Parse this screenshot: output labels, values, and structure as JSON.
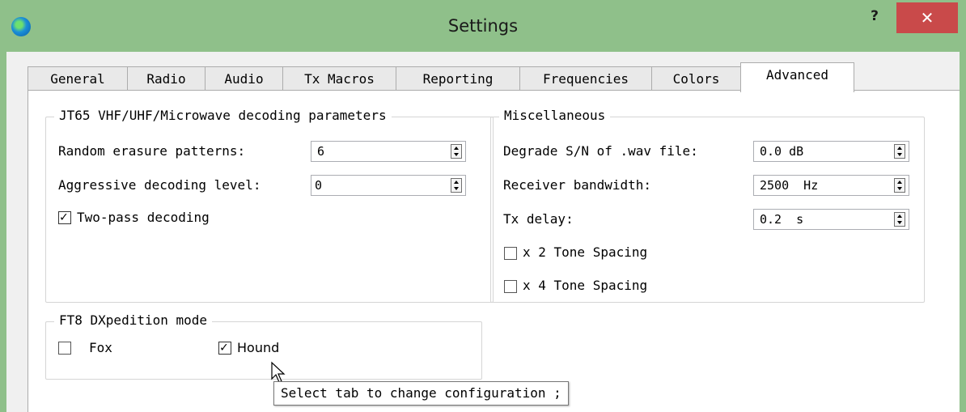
{
  "window": {
    "title": "Settings",
    "help_label": "?",
    "close_label": "✕"
  },
  "tabs": [
    {
      "label": "General"
    },
    {
      "label": "Radio"
    },
    {
      "label": "Audio"
    },
    {
      "label": "Tx Macros"
    },
    {
      "label": "Reporting"
    },
    {
      "label": "Frequencies"
    },
    {
      "label": "Colors"
    },
    {
      "label": "Advanced",
      "active": true
    }
  ],
  "jt65": {
    "legend": "JT65 VHF/UHF/Microwave decoding parameters",
    "random_erasure_label": "Random erasure patterns:",
    "random_erasure_value": "6",
    "aggressive_label": "Aggressive decoding level:",
    "aggressive_value": "0",
    "two_pass_label": "Two-pass decoding",
    "two_pass_checked": true
  },
  "misc": {
    "legend": "Miscellaneous",
    "degrade_label": "Degrade S/N of .wav file:",
    "degrade_value": "0.0 dB",
    "bandwidth_label": "Receiver bandwidth:",
    "bandwidth_value": "2500  Hz",
    "txdelay_label": "Tx delay:",
    "txdelay_value": "0.2  s",
    "x2_label": "x 2 Tone Spacing",
    "x2_checked": false,
    "x4_label": "x 4 Tone Spacing",
    "x4_checked": false
  },
  "ft8": {
    "legend": "FT8 DXpedition mode",
    "fox_label": "Fox",
    "fox_checked": false,
    "hound_label": "Hound",
    "hound_checked": true
  },
  "tooltip": {
    "text": "Select tab to change configuration ;"
  },
  "colors": {
    "frame": "#8fc08a",
    "close": "#c94a4a"
  }
}
